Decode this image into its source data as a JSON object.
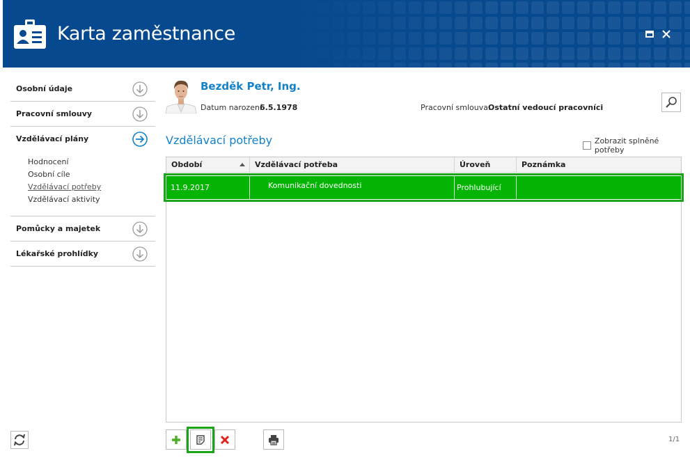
{
  "window": {
    "title": "Karta zaměstnance",
    "icon": "id-card-icon",
    "header_bg": "#07498f"
  },
  "sidebar": {
    "sections": [
      {
        "label": "Osobní údaje",
        "icon": "arrow-down-circle-icon"
      },
      {
        "label": "Pracovní smlouvy",
        "icon": "arrow-down-circle-icon"
      },
      {
        "label": "Vzdělávací plány",
        "icon": "arrow-right-circle-icon",
        "expanded": true,
        "items": [
          {
            "label": "Hodnocení"
          },
          {
            "label": "Osobní cíle"
          },
          {
            "label": "Vzdělávací potřeby",
            "active": true
          },
          {
            "label": "Vzdělávací aktivity"
          }
        ]
      },
      {
        "label": "Pomůcky a majetek",
        "icon": "arrow-down-circle-icon"
      },
      {
        "label": "Lékařské prohlídky",
        "icon": "arrow-down-circle-icon"
      }
    ]
  },
  "employee": {
    "name": "Bezděk Petr, Ing.",
    "dob_label": "Datum narození:",
    "dob": "6.5.1978",
    "contract_label": "Pracovní smlouva:",
    "contract": "Ostatní vedoucí pracovníci"
  },
  "section": {
    "title": "Vzdělávací potřeby",
    "show_completed_label": "Zobrazit splněné potřeby",
    "show_completed": false
  },
  "grid": {
    "columns": [
      "Období",
      "Vzdělávací potřeba",
      "Úroveň",
      "Poznámka"
    ],
    "sort_column": "Období",
    "sort_dir": "asc",
    "rows": [
      {
        "period": "11.9.2017",
        "need": "Komunikační dovednosti",
        "level": "Prohlubující",
        "note": ""
      }
    ],
    "selected_color": "#05b405",
    "highlight_color": "#1aa51a"
  },
  "toolbar": {
    "add": "plus-icon",
    "edit": "edit-icon",
    "delete": "delete-icon",
    "print": "print-icon",
    "refresh": "refresh-icon"
  },
  "pager": {
    "text": "1/1"
  }
}
